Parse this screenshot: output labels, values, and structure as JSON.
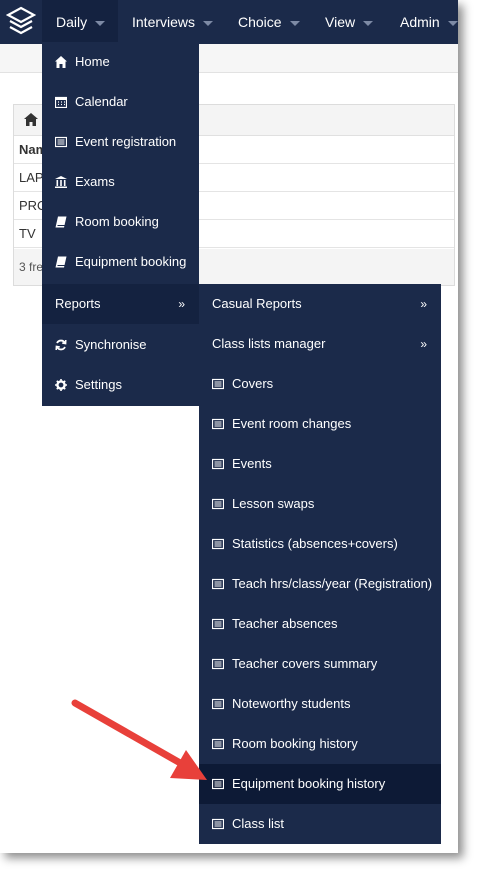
{
  "navbar": {
    "items": [
      {
        "label": "Daily",
        "active": true
      },
      {
        "label": "Interviews"
      },
      {
        "label": "Choice"
      },
      {
        "label": "View"
      },
      {
        "label": "Admin"
      }
    ]
  },
  "table": {
    "header_label": "Nam",
    "rows": [
      "LAP",
      "PRO",
      "TV"
    ],
    "footer": "3 fre"
  },
  "daily_menu": {
    "items": [
      {
        "label": "Home",
        "icon": "home-icon"
      },
      {
        "label": "Calendar",
        "icon": "calendar-icon"
      },
      {
        "label": "Event registration",
        "icon": "list-icon"
      },
      {
        "label": "Exams",
        "icon": "bank-icon"
      },
      {
        "label": "Room booking",
        "icon": "book-icon"
      },
      {
        "label": "Equipment booking",
        "icon": "book-icon"
      },
      {
        "label": "Reports",
        "arrow": "»"
      },
      {
        "label": "Synchronise",
        "icon": "refresh-icon"
      },
      {
        "label": "Settings",
        "icon": "gear-icon"
      }
    ]
  },
  "reports_menu": {
    "items": [
      {
        "label": "Casual Reports",
        "arrow": "»"
      },
      {
        "label": "Class lists manager",
        "arrow": "»"
      },
      {
        "label": "Covers",
        "icon": "list-icon"
      },
      {
        "label": "Event room changes",
        "icon": "list-icon"
      },
      {
        "label": "Events",
        "icon": "list-icon"
      },
      {
        "label": "Lesson swaps",
        "icon": "list-icon"
      },
      {
        "label": "Statistics (absences+covers)",
        "icon": "list-icon"
      },
      {
        "label": "Teach hrs/class/year (Registration)",
        "icon": "list-icon"
      },
      {
        "label": "Teacher absences",
        "icon": "list-icon"
      },
      {
        "label": "Teacher covers summary",
        "icon": "list-icon"
      },
      {
        "label": "Noteworthy students",
        "icon": "list-icon"
      },
      {
        "label": "Room booking history",
        "icon": "list-icon"
      },
      {
        "label": "Equipment booking history",
        "icon": "list-icon",
        "highlighted": true
      },
      {
        "label": "Class list",
        "icon": "list-icon"
      }
    ]
  },
  "colors": {
    "navbar_bg": "#1b2a4a",
    "menu_bg": "#1b2a4a",
    "highlight_bg": "#0d1a36",
    "callout_arrow": "#e8403a"
  }
}
